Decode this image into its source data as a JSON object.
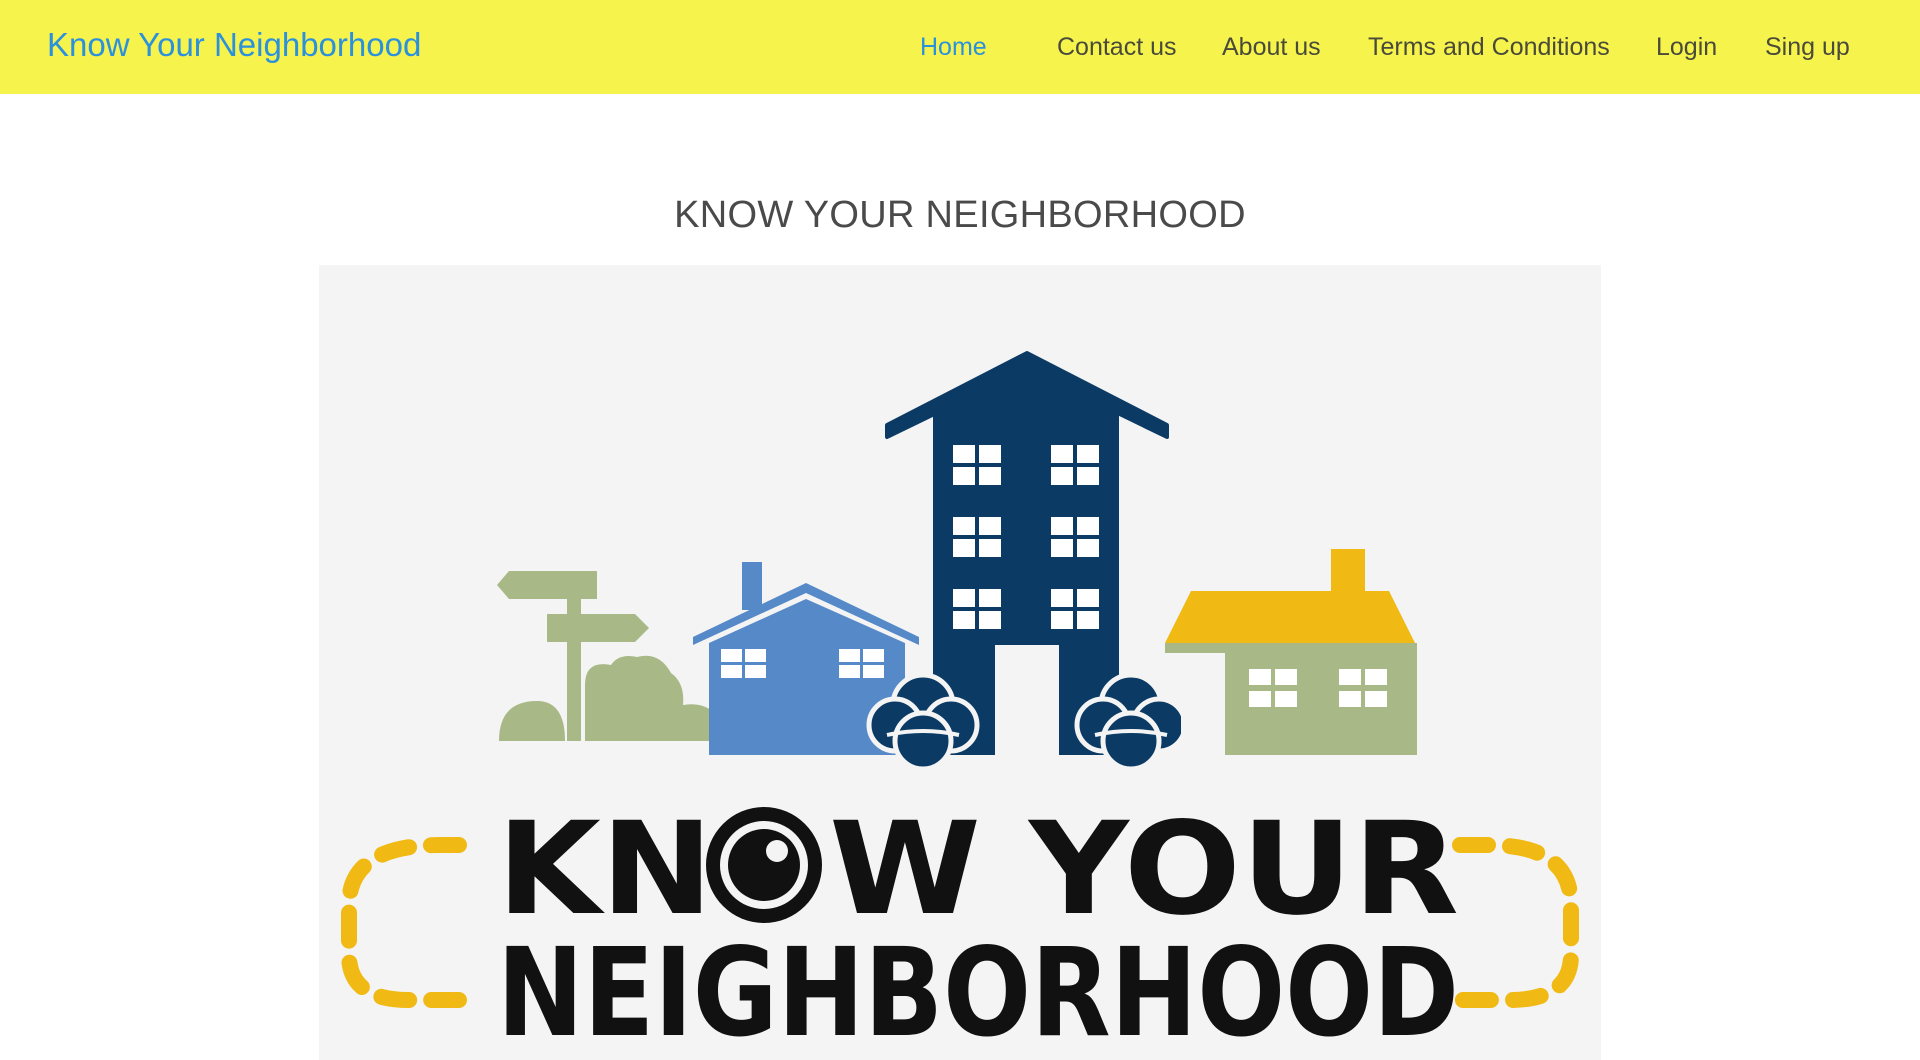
{
  "header": {
    "brand": "Know Your Neighborhood",
    "nav": [
      {
        "label": "Home",
        "active": true
      },
      {
        "label": "Contact us",
        "active": false
      },
      {
        "label": "About us",
        "active": false
      },
      {
        "label": "Terms and Conditions",
        "active": false
      },
      {
        "label": "Login",
        "active": false
      },
      {
        "label": "Sing up",
        "active": false
      }
    ]
  },
  "main": {
    "title": "KNOW YOUR NEIGHBORHOOD",
    "logo": {
      "line1_pre": "KN",
      "line1_post": "W YOUR",
      "line2": "NEIGHBORHOOD"
    }
  },
  "colors": {
    "navbar": "#f5f34c",
    "brand": "#2b91dc",
    "tower": "#0b3a64",
    "house_blue": "#5589c8",
    "house_green": "#a8b886",
    "roof_yellow": "#f1b914",
    "dash_yellow": "#f1b914"
  }
}
